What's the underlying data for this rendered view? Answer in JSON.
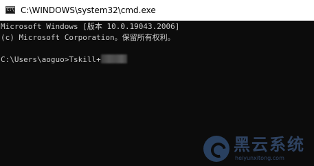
{
  "window": {
    "title": "C:\\WINDOWS\\system32\\cmd.exe",
    "icon": "cmd-icon"
  },
  "console": {
    "lines": [
      "Microsoft Windows [版本 10.0.19043.2006]",
      "(c) Microsoft Corporation。保留所有权利。",
      "",
      "C:\\Users\\aoguo>Tskill+"
    ]
  },
  "watermark": {
    "title": "黑云系统",
    "subtitle": "heiyunxitong.com",
    "color": "#32486a"
  },
  "colors": {
    "console_bg": "#0c0c0c",
    "console_text": "#cccccc",
    "titlebar_bg": "#ffffff"
  }
}
